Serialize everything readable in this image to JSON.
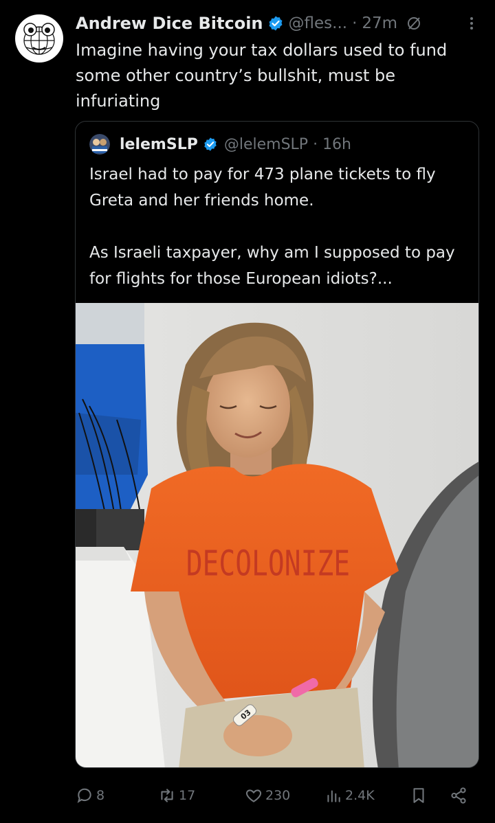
{
  "tweet": {
    "author_name": "Andrew Dice Bitcoin",
    "handle": "@fles...",
    "separator": "·",
    "time": "27m",
    "text": "Imagine having your tax dollars used to fund some other country’s bullshit, must be infuriating"
  },
  "quoted": {
    "author_name": "lelemSLP",
    "handle": "@lelemSLP",
    "separator": "·",
    "time": "16h",
    "paragraph1": "Israel had to pay for 473 plane tickets to fly Greta and her friends home.",
    "paragraph2": "As Israeli taxpayer, why am I supposed to pay for flights for those European idiots?...",
    "shirt_text": "DECOLONIZE",
    "wristband_text": "03"
  },
  "actions": {
    "replies": "8",
    "reposts": "17",
    "likes": "230",
    "views": "2.4K"
  },
  "colors": {
    "background": "#000000",
    "text": "#e7e9ea",
    "muted": "#71767b",
    "verified": "#1d9bf0",
    "border": "#2f3336"
  }
}
